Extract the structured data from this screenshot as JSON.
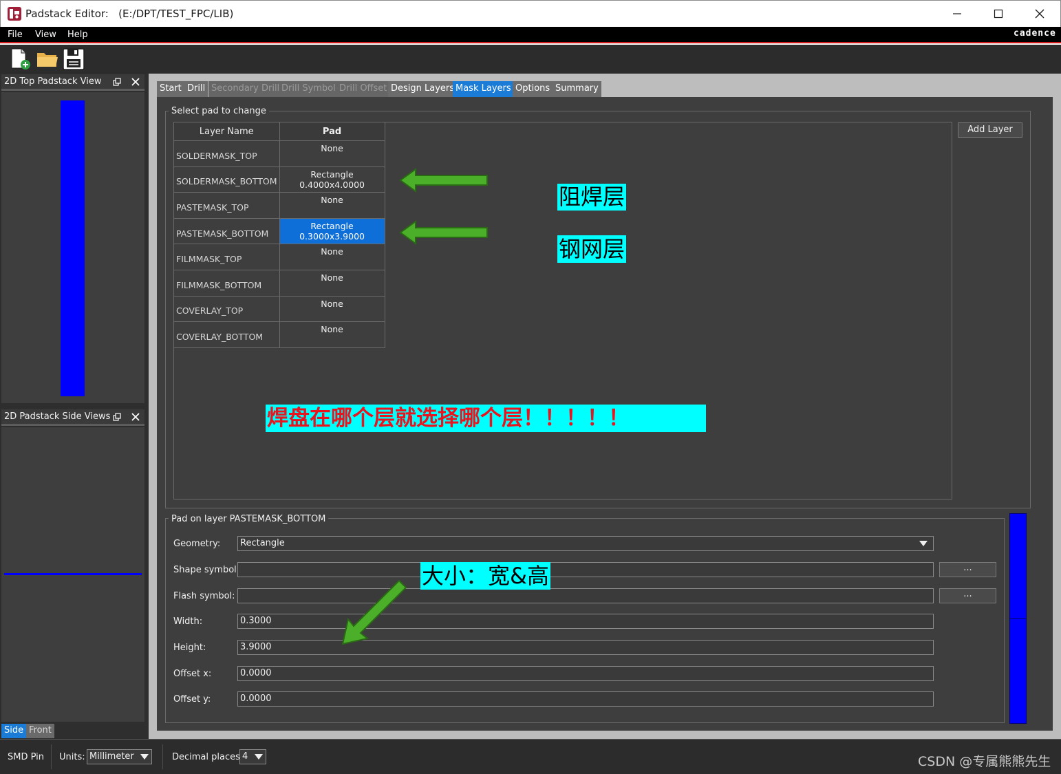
{
  "window": {
    "title": "Padstack Editor:   (E:/DPT/TEST_FPC/LIB)"
  },
  "menu": {
    "items": [
      "File",
      "View",
      "Help"
    ],
    "brand": "cadence"
  },
  "toolbar": {
    "buttons": [
      "new-file-icon",
      "open-folder-icon",
      "save-icon"
    ]
  },
  "docks": {
    "top_view_title": "2D Top Padstack View",
    "side_view_title": "2D Padstack Side Views",
    "side_tabs": [
      "Side",
      "Front"
    ],
    "active_side_tab": "Side"
  },
  "tabs": {
    "items": [
      "Start",
      "Drill",
      "Secondary Drill",
      "Drill Symbol",
      "Drill Offset",
      "Design Layers",
      "Mask Layers",
      "Options",
      "Summary"
    ],
    "disabled": [
      "Secondary Drill",
      "Drill Symbol",
      "Drill Offset"
    ],
    "active": "Mask Layers"
  },
  "select_pad": {
    "group_title": "Select pad to change",
    "col_layer": "Layer Name",
    "col_pad": "Pad",
    "add_layer_label": "Add Layer",
    "rows": [
      {
        "layer": "SOLDERMASK_TOP",
        "pad": "None"
      },
      {
        "layer": "SOLDERMASK_BOTTOM",
        "pad": "Rectangle 0.4000x4.0000"
      },
      {
        "layer": "PASTEMASK_TOP",
        "pad": "None"
      },
      {
        "layer": "PASTEMASK_BOTTOM",
        "pad": "Rectangle 0.3000x3.9000",
        "selected": true
      },
      {
        "layer": "FILMMASK_TOP",
        "pad": "None"
      },
      {
        "layer": "FILMMASK_BOTTOM",
        "pad": "None"
      },
      {
        "layer": "COVERLAY_TOP",
        "pad": "None"
      },
      {
        "layer": "COVERLAY_BOTTOM",
        "pad": "None"
      }
    ]
  },
  "pad_form": {
    "group_title": "Pad on layer PASTEMASK_BOTTOM",
    "geometry_label": "Geometry:",
    "geometry_value": "Rectangle",
    "shape_symbol_label": "Shape symbol:",
    "shape_symbol_value": "",
    "flash_symbol_label": "Flash symbol:",
    "flash_symbol_value": "",
    "ellipsis": "...",
    "width_label": "Width:",
    "width_value": "0.3000",
    "height_label": "Height:",
    "height_value": "3.9000",
    "offset_x_label": "Offset x:",
    "offset_x_value": "0.0000",
    "offset_y_label": "Offset y:",
    "offset_y_value": "0.0000"
  },
  "status": {
    "pin_type": "SMD Pin",
    "units_label": "Units:",
    "units_value": "Millimeter",
    "decimal_label": "Decimal places:",
    "decimal_value": "4",
    "watermark": "CSDN @专属熊熊先生"
  },
  "annotations": {
    "soldermask_note": "阻焊层",
    "pastemask_note": "钢网层",
    "layer_select_note": "焊盘在哪个层就选择哪个层！！！！！",
    "size_note": "大小：宽&高"
  },
  "colors": {
    "accent_blue": "#1a7cd6",
    "pad_blue": "#0000ff",
    "annotation_bg": "#00ffff",
    "annotation_red": "#e8141e",
    "arrow_green": "#4caf2a"
  }
}
